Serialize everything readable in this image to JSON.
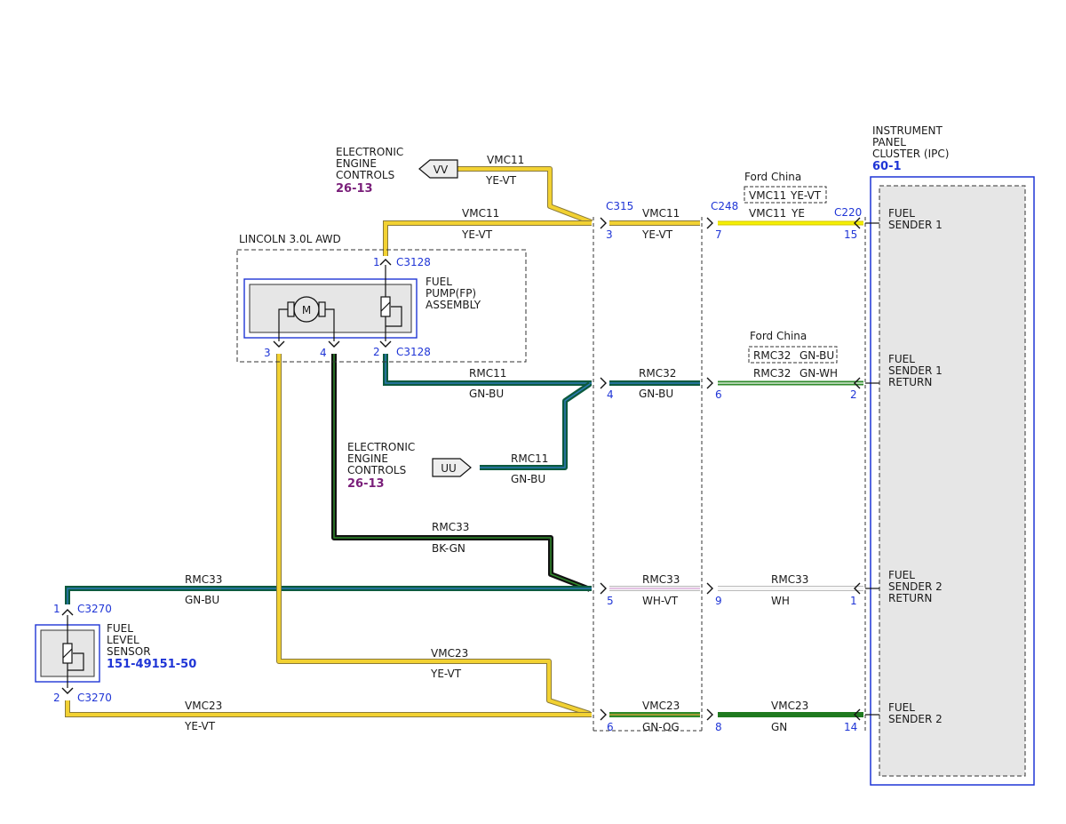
{
  "colors": {
    "yellow": "#f2d132",
    "yellow_edge": "#8a7a3a",
    "dark_green": "#0c5a3e",
    "green": "#2f8a2a",
    "black": "#111111",
    "white_wire": "#e8e8e8",
    "pink": "#d9a3d9",
    "connector_blue": "#1f35d6",
    "ref_purple": "#7a1f7a",
    "ipc_fill": "#e6e6e6"
  },
  "components": {
    "eec_top": {
      "name_lines": [
        "ELECTRONIC",
        "ENGINE",
        "CONTROLS"
      ],
      "ref": "26-13"
    },
    "eec_mid": {
      "name_lines": [
        "ELECTRONIC",
        "ENGINE",
        "CONTROLS"
      ],
      "ref": "26-13"
    },
    "vv_label": "VV",
    "uu_label": "UU",
    "lincoln_label": "LINCOLN 3.0L AWD",
    "fuel_pump": {
      "name_lines": [
        "FUEL",
        "PUMP(FP)",
        "ASSEMBLY"
      ],
      "motor_symbol": "M"
    },
    "fuel_level_sensor": {
      "name_lines": [
        "FUEL",
        "LEVEL",
        "SENSOR"
      ],
      "ref": "151-49151-50"
    },
    "ipc": {
      "name_lines": [
        "INSTRUMENT",
        "PANEL",
        "CLUSTER (IPC)"
      ],
      "ref": "60-1"
    }
  },
  "connectors": {
    "c315": "C315",
    "c248": "C248",
    "c220": "C220",
    "c3128_top": "C3128",
    "c3128_bottom": "C3128",
    "c3270_top": "C3270",
    "c3270_bottom": "C3270"
  },
  "pins": {
    "c3128_1": "1",
    "c3128_2": "2",
    "fp_3": "3",
    "fp_4": "4",
    "c315_3": "3",
    "c315_4": "4",
    "c315_5": "5",
    "c315_6": "6",
    "c248_7": "7",
    "c248_6": "6",
    "c248_9": "9",
    "c248_8": "8",
    "c220_15": "15",
    "c220_2": "2",
    "c220_1": "1",
    "c220_14": "14",
    "c3270_1": "1",
    "c3270_2": "2"
  },
  "wires": {
    "vmc11_vv": {
      "circuit": "VMC11",
      "color": "YE-VT"
    },
    "vmc11_pump": {
      "circuit": "VMC11",
      "color": "YE-VT"
    },
    "vmc11_c315": {
      "circuit": "VMC11",
      "color": "YE-VT"
    },
    "vmc11_c248": {
      "circuit": "VMC11",
      "color": "YE"
    },
    "rmc11_pump": {
      "circuit": "RMC11",
      "color": "GN-BU"
    },
    "rmc32_c315": {
      "circuit": "RMC32",
      "color": "GN-BU"
    },
    "rmc32_c248": {
      "circuit": "RMC32",
      "color": "GN-WH"
    },
    "rmc11_uu": {
      "circuit": "RMC11",
      "color": "GN-BU"
    },
    "rmc33_pump": {
      "circuit": "RMC33",
      "color": "BK-GN"
    },
    "rmc33_sensor": {
      "circuit": "RMC33",
      "color": "GN-BU"
    },
    "rmc33_c315": {
      "circuit": "RMC33",
      "color": "WH-VT"
    },
    "rmc33_c248": {
      "circuit": "RMC33",
      "color": "WH"
    },
    "vmc23_pump": {
      "circuit": "VMC23",
      "color": "YE-VT"
    },
    "vmc23_sensor": {
      "circuit": "VMC23",
      "color": "YE-VT"
    },
    "vmc23_c315": {
      "circuit": "VMC23",
      "color": "GN-OG"
    },
    "vmc23_c248": {
      "circuit": "VMC23",
      "color": "GN"
    }
  },
  "ford_china": {
    "top": {
      "label": "Ford China",
      "circuit": "VMC11",
      "color": "YE-VT"
    },
    "bottom": {
      "label": "Ford China",
      "circuit": "RMC32",
      "color": "GN-BU"
    }
  },
  "ipc_inputs": {
    "sender1": [
      "FUEL",
      "SENDER 1"
    ],
    "sender1_return": [
      "FUEL",
      "SENDER 1",
      "RETURN"
    ],
    "sender2_return": [
      "FUEL",
      "SENDER 2",
      "RETURN"
    ],
    "sender2": [
      "FUEL",
      "SENDER 2"
    ]
  }
}
